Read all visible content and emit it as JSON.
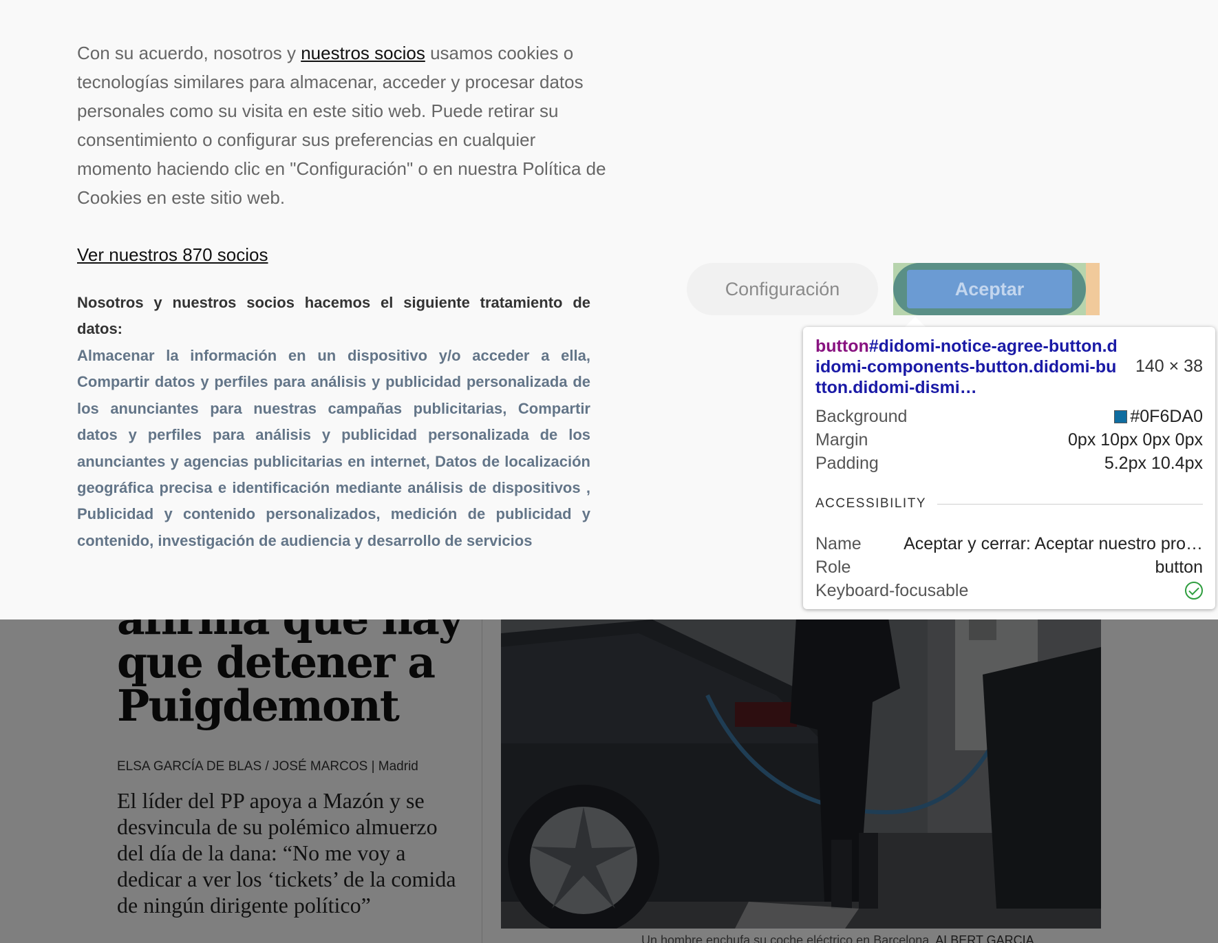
{
  "consent": {
    "intro_before": "Con su acuerdo, nosotros y ",
    "intro_link": "nuestros socios",
    "intro_after": " usamos cookies o tecnologías similares para almacenar, acceder y procesar datos personales como su visita en este sitio web. Puede retirar su consentimiento o configurar sus preferencias en cualquier momento haciendo clic en \"Configuración\" o en nuestra Política de Cookies en este sitio web.",
    "partners_link": "Ver nuestros 870 socios",
    "processing_title": "Nosotros y nuestros socios hacemos el siguiente tratamiento de datos:",
    "processing_list": "Almacenar la información en un dispositivo y/o acceder a ella, Compartir datos y perfiles para análisis y publicidad personalizada de los anunciantes para nuestras campañas publicitarias, Compartir datos y perfiles para análisis y publicidad personalizada de los anunciantes y agencias publicitarias en internet, Datos de localización geográfica precisa e identificación mediante análisis de dispositivos , Publicidad y contenido personalizados, medición de publicidad y contenido, investigación de audiencia y desarrollo de servicios",
    "config_button": "Configuración",
    "accept_button": "Aceptar"
  },
  "devtools": {
    "tag": "button",
    "selector": "#didomi-notice-agree-button.didomi-components-button.didomi-button.didomi-dismi…",
    "size": "140 × 38",
    "background_label": "Background",
    "background_value": "#0F6DA0",
    "margin_label": "Margin",
    "margin_value": "0px 10px 0px 0px",
    "padding_label": "Padding",
    "padding_value": "5.2px 10.4px",
    "section": "ACCESSIBILITY",
    "name_label": "Name",
    "name_value": "Aceptar y cerrar: Aceptar nuestro pro…",
    "role_label": "Role",
    "role_value": "button",
    "focusable_label": "Keyboard-focusable",
    "colors": {
      "swatch": "#0F6DA0",
      "tag": "#881280",
      "selector": "#1A1AA6",
      "check": "#2E9D3E"
    }
  },
  "article": {
    "headline_lines": [
      "afirma que hay",
      "que detener a",
      "Puigdemont"
    ],
    "byline_authors": "ELSA GARCÍA DE BLAS / JOSÉ MARCOS",
    "byline_location": " | Madrid",
    "summary": "El líder del PP apoya a Mazón y se desvincula de su polémico almuerzo del día de la dana: “No me voy a dedicar a ver los ‘tickets’ de la comida de ningún dirigente político”",
    "photo_caption": "Un hombre enchufa su coche eléctrico en Barcelona.",
    "photo_credit": "ALBERT GARCIA"
  }
}
